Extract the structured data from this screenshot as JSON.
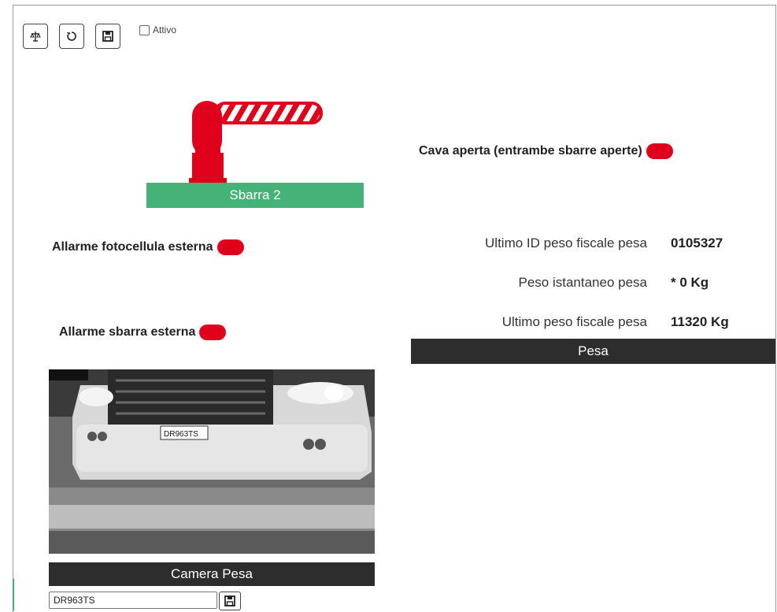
{
  "toolbar": {
    "buttons": [
      {
        "name": "scale-button",
        "icon": "scale-icon"
      },
      {
        "name": "refresh-button",
        "icon": "refresh-icon"
      },
      {
        "name": "save-button",
        "icon": "save-icon"
      }
    ],
    "active_label": "Attivo",
    "active_checked": false
  },
  "barrier": {
    "label": "Sbarra 2",
    "status_color": "#e0001b",
    "base_color": "#45b377"
  },
  "status": {
    "cava": "Cava aperta (entrambe sbarre aperte)",
    "fotocellula": "Allarme fotocellula esterna",
    "sbarra": "Allarme sbarra esterna"
  },
  "metrics": [
    {
      "label": "Ultimo ID peso fiscale pesa",
      "value": "0105327"
    },
    {
      "label": "Peso istantaneo pesa",
      "value": "* 0 Kg"
    },
    {
      "label": "Ultimo peso fiscale pesa",
      "value": "11320 Kg"
    }
  ],
  "pesa_header": "Pesa",
  "camera": {
    "header": "Camera Pesa",
    "plate_reading": "DR963TS",
    "plate_value": "DR963TS"
  }
}
